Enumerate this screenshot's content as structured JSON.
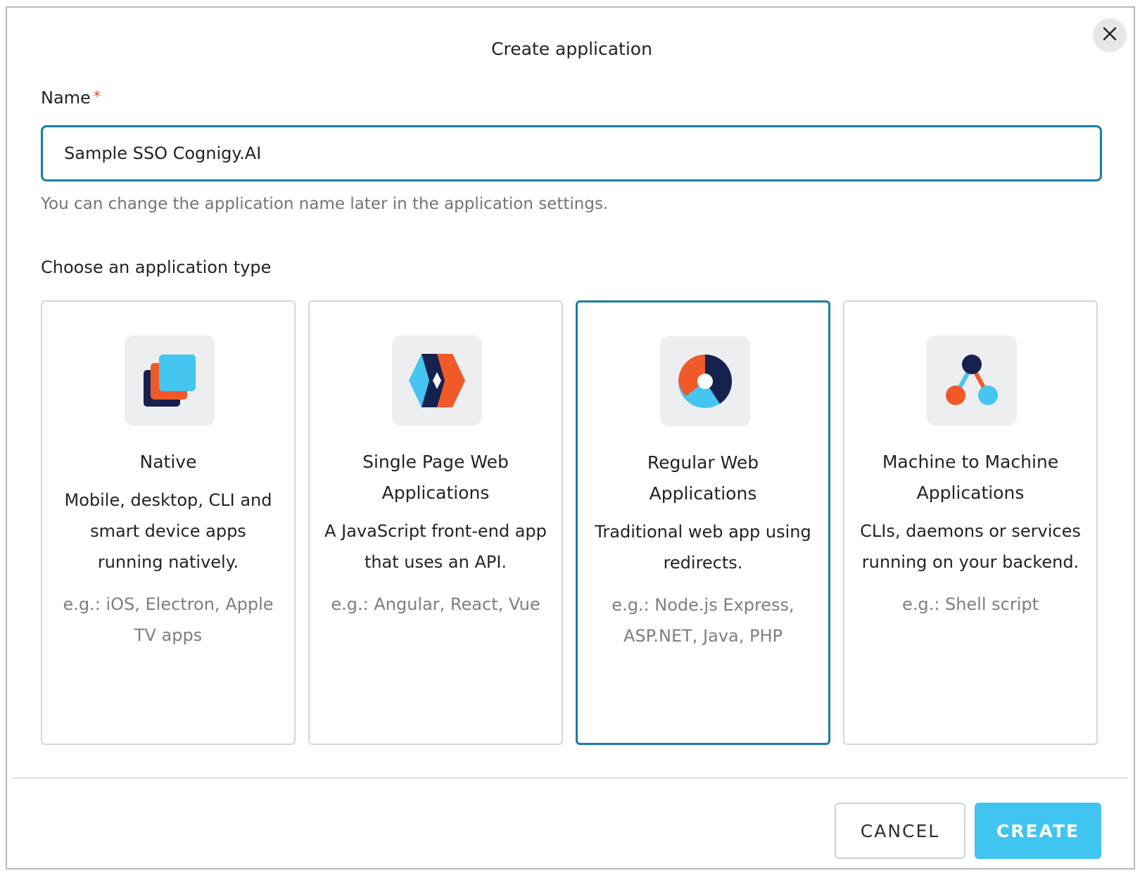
{
  "dialog": {
    "title": "Create application",
    "close_icon": "close-icon"
  },
  "name_field": {
    "label": "Name",
    "required_mark": "*",
    "value": "Sample SSO Cognigy.AI",
    "hint": "You can change the application name later in the application settings."
  },
  "app_type": {
    "label": "Choose an application type",
    "selected": "Regular Web Applications",
    "cards": [
      {
        "icon": "native-icon",
        "title": "Native",
        "description": "Mobile, desktop, CLI and smart device apps running natively.",
        "example": "e.g.: iOS, Electron, Apple TV apps"
      },
      {
        "icon": "spa-icon",
        "title": "Single Page Web Applications",
        "description": "A JavaScript front-end app that uses an API.",
        "example": "e.g.: Angular, React, Vue"
      },
      {
        "icon": "regular-web-icon",
        "title": "Regular Web Applications",
        "description": "Traditional web app using redirects.",
        "example": "e.g.: Node.js Express, ASP.NET, Java, PHP"
      },
      {
        "icon": "m2m-icon",
        "title": "Machine to Machine Applications",
        "description": "CLIs, daemons or services running on your backend.",
        "example": "e.g.: Shell script"
      }
    ]
  },
  "footer": {
    "cancel_label": "CANCEL",
    "create_label": "CREATE"
  },
  "colors": {
    "accent": "#1a7ea3",
    "create_button": "#40c4f0",
    "required": "#e0442c",
    "icon_orange": "#f05a28",
    "icon_navy": "#16214d",
    "icon_lightblue": "#44c6f0"
  }
}
